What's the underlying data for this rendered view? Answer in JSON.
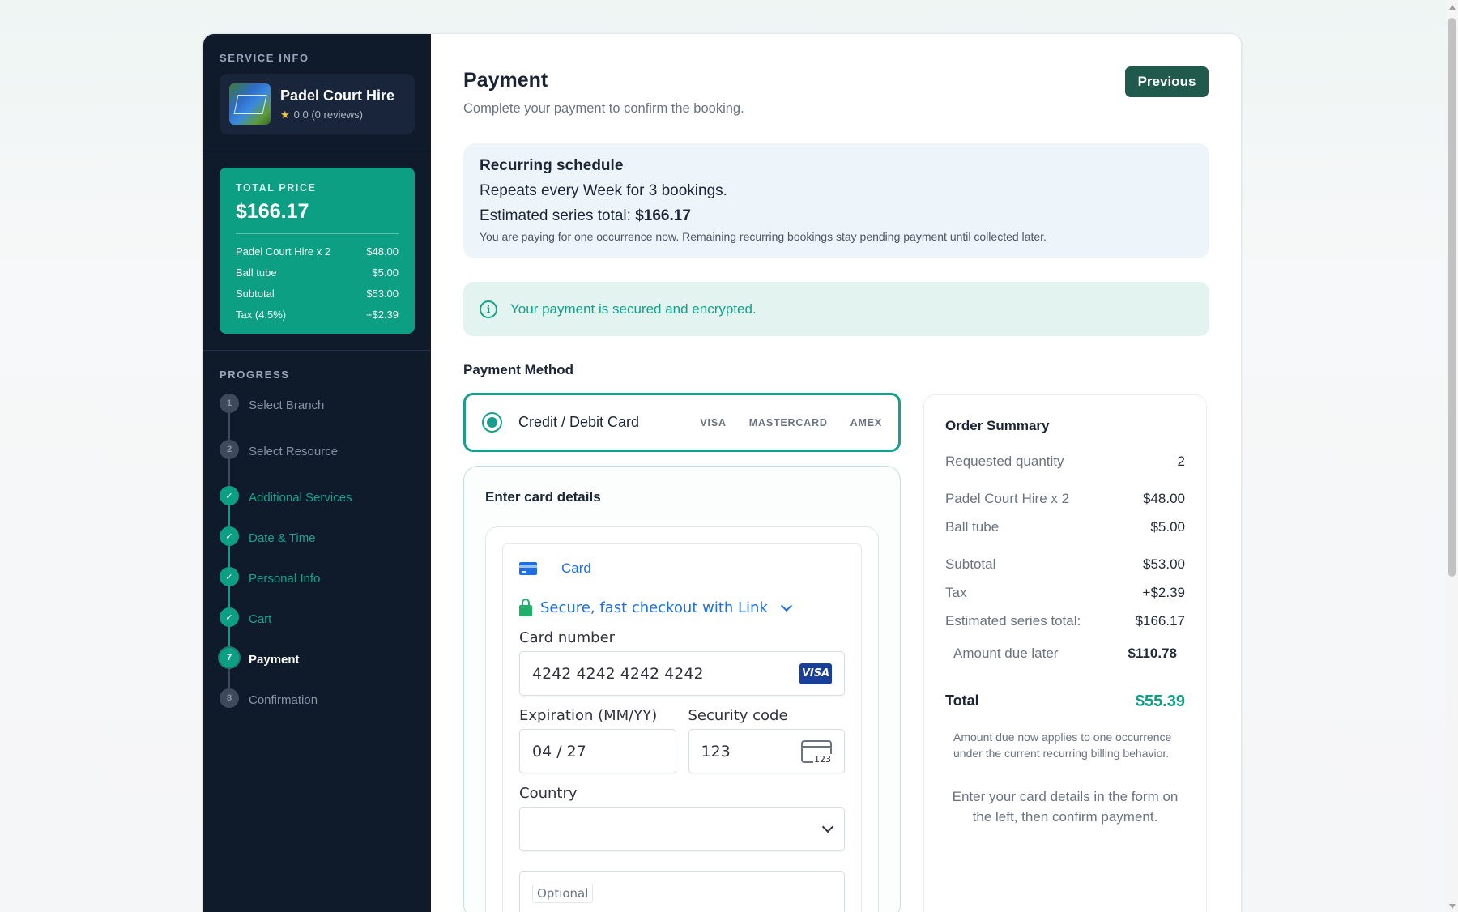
{
  "sidebar": {
    "service_info_label": "SERVICE INFO",
    "service": {
      "name": "Padel Court Hire",
      "rating": "0.0 (0 reviews)"
    },
    "price": {
      "label": "TOTAL PRICE",
      "total": "$166.17",
      "rows": [
        {
          "label": "Padel Court Hire x 2",
          "value": "$48.00"
        },
        {
          "label": "Ball tube",
          "value": "$5.00"
        },
        {
          "label": "Subtotal",
          "value": "$53.00"
        },
        {
          "label": "Tax (4.5%)",
          "value": "+$2.39"
        }
      ]
    },
    "progress_label": "PROGRESS",
    "steps": [
      {
        "num": "1",
        "label": "Select Branch",
        "state": "todo"
      },
      {
        "num": "2",
        "label": "Select Resource",
        "state": "todo"
      },
      {
        "num": "✓",
        "label": "Additional Services",
        "state": "done"
      },
      {
        "num": "✓",
        "label": "Date & Time",
        "state": "done"
      },
      {
        "num": "✓",
        "label": "Personal Info",
        "state": "done"
      },
      {
        "num": "✓",
        "label": "Cart",
        "state": "done"
      },
      {
        "num": "7",
        "label": "Payment",
        "state": "active"
      },
      {
        "num": "8",
        "label": "Confirmation",
        "state": "todo"
      }
    ]
  },
  "header": {
    "title": "Payment",
    "subtitle": "Complete your payment to confirm the booking.",
    "previous_label": "Previous"
  },
  "recurring": {
    "title": "Recurring schedule",
    "repeat": "Repeats every Week for 3 bookings.",
    "series_prefix": "Estimated series total: ",
    "series_total": "$166.17",
    "note": "You are paying for one occurrence now. Remaining recurring bookings stay pending payment until collected later."
  },
  "secure_message": "Your payment is secured and encrypted.",
  "payment_method": {
    "label": "Payment Method",
    "option": "Credit / Debit Card",
    "brands": [
      "VISA",
      "MASTERCARD",
      "AMEX"
    ]
  },
  "card_form": {
    "title": "Enter card details",
    "tab": "Card",
    "link": "Secure, fast checkout with Link",
    "card_number_label": "Card number",
    "card_number": "4242 4242 4242 4242",
    "card_brand": "VISA",
    "expiry_label": "Expiration (MM/YY)",
    "expiry": "04 / 27",
    "cvc_label": "Security code",
    "cvc": "123",
    "cvc_icon_text": "123",
    "country_label": "Country",
    "country": "",
    "optional": "Optional"
  },
  "summary": {
    "title": "Order Summary",
    "requested_label": "Requested quantity",
    "requested_value": "2",
    "items": [
      {
        "label": "Padel Court Hire x 2",
        "value": "$48.00"
      },
      {
        "label": "Ball tube",
        "value": "$5.00"
      }
    ],
    "subtotal_label": "Subtotal",
    "subtotal": "$53.00",
    "tax_label": "Tax",
    "tax": "+$2.39",
    "series_label": "Estimated series total:",
    "series": "$166.17",
    "due_later_label": "Amount due later",
    "due_later": "$110.78",
    "total_label": "Total",
    "total": "$55.39",
    "note": "Amount due now applies to one occurrence under the current recurring billing behavior.",
    "footer": "Enter your card details in the form on the left, then confirm payment."
  },
  "colors": {
    "accent": "#0d9f84",
    "sidebar_bg": "#0f1a2a",
    "button_bg": "#1f5a4c",
    "link_blue": "#1f6fe0"
  }
}
